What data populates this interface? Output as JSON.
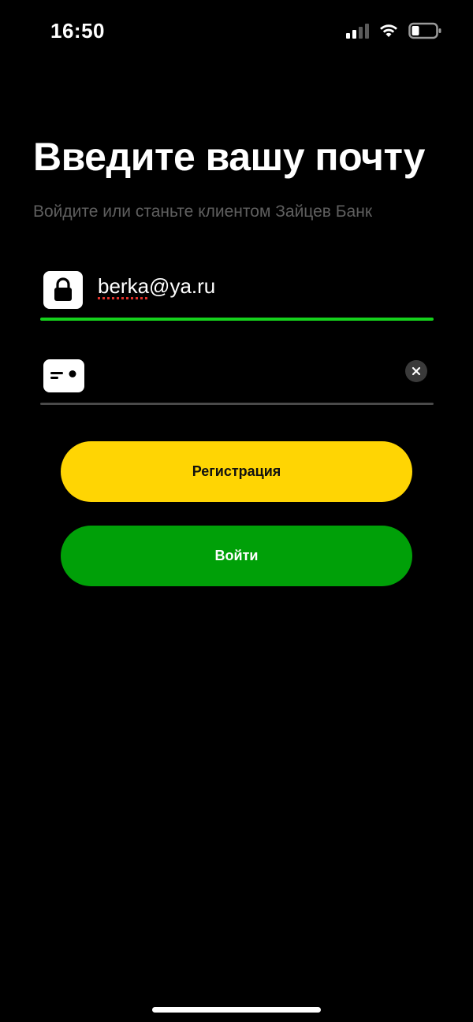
{
  "status_bar": {
    "time": "16:50"
  },
  "screen": {
    "title": "Введите вашу почту",
    "subtitle": "Войдите или станьте клиентом Зайцев Банк"
  },
  "email_field": {
    "value_misspelled": "berka",
    "value_rest": "@ya.ru",
    "icon": "lock-icon",
    "state": "focused",
    "accent_color": "#15d11c"
  },
  "card_field": {
    "value": "",
    "icon": "card-icon",
    "clear_icon": "clear-icon"
  },
  "buttons": {
    "register_label": "Регистрация",
    "register_color": "#ffd503",
    "login_label": "Войти",
    "login_color": "#00a008"
  }
}
